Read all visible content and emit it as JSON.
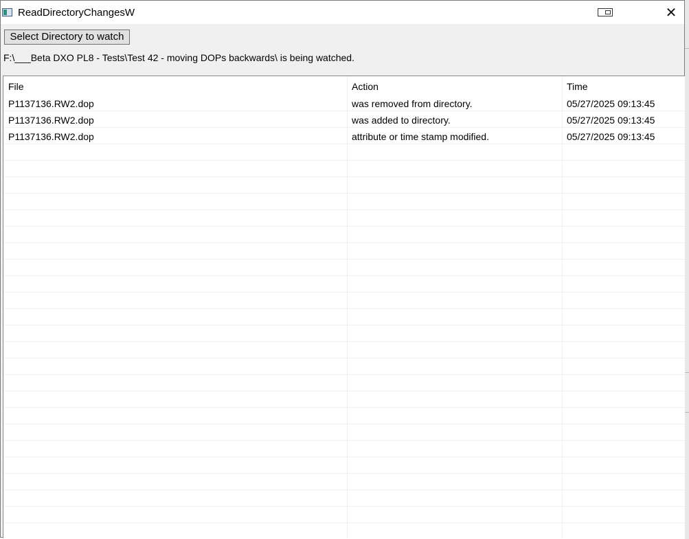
{
  "window": {
    "title": "ReadDirectoryChangesW"
  },
  "toolbar": {
    "select_button_label": "Select Directory to watch"
  },
  "status": {
    "watched_text": "F:\\___Beta DXO PL8 - Tests\\Test 42 - moving DOPs backwards\\ is being watched."
  },
  "table": {
    "columns": [
      "File",
      "Action",
      "Time"
    ],
    "rows": [
      [
        "P1137136.RW2.dop",
        "was removed from directory.",
        "05/27/2025 09:13:45"
      ],
      [
        "P1137136.RW2.dop",
        "was added to directory.",
        "05/27/2025 09:13:45"
      ],
      [
        "P1137136.RW2.dop",
        "attribute or time stamp modified.",
        "05/27/2025 09:13:45"
      ]
    ]
  },
  "colors": {
    "window_bg": "#f0f0f0",
    "list_bg": "#ffffff",
    "grid_line": "#f0f0f0"
  },
  "icons": {
    "app": "app-window-icon",
    "snap": "snap-layout-icon",
    "close": "close-icon"
  }
}
